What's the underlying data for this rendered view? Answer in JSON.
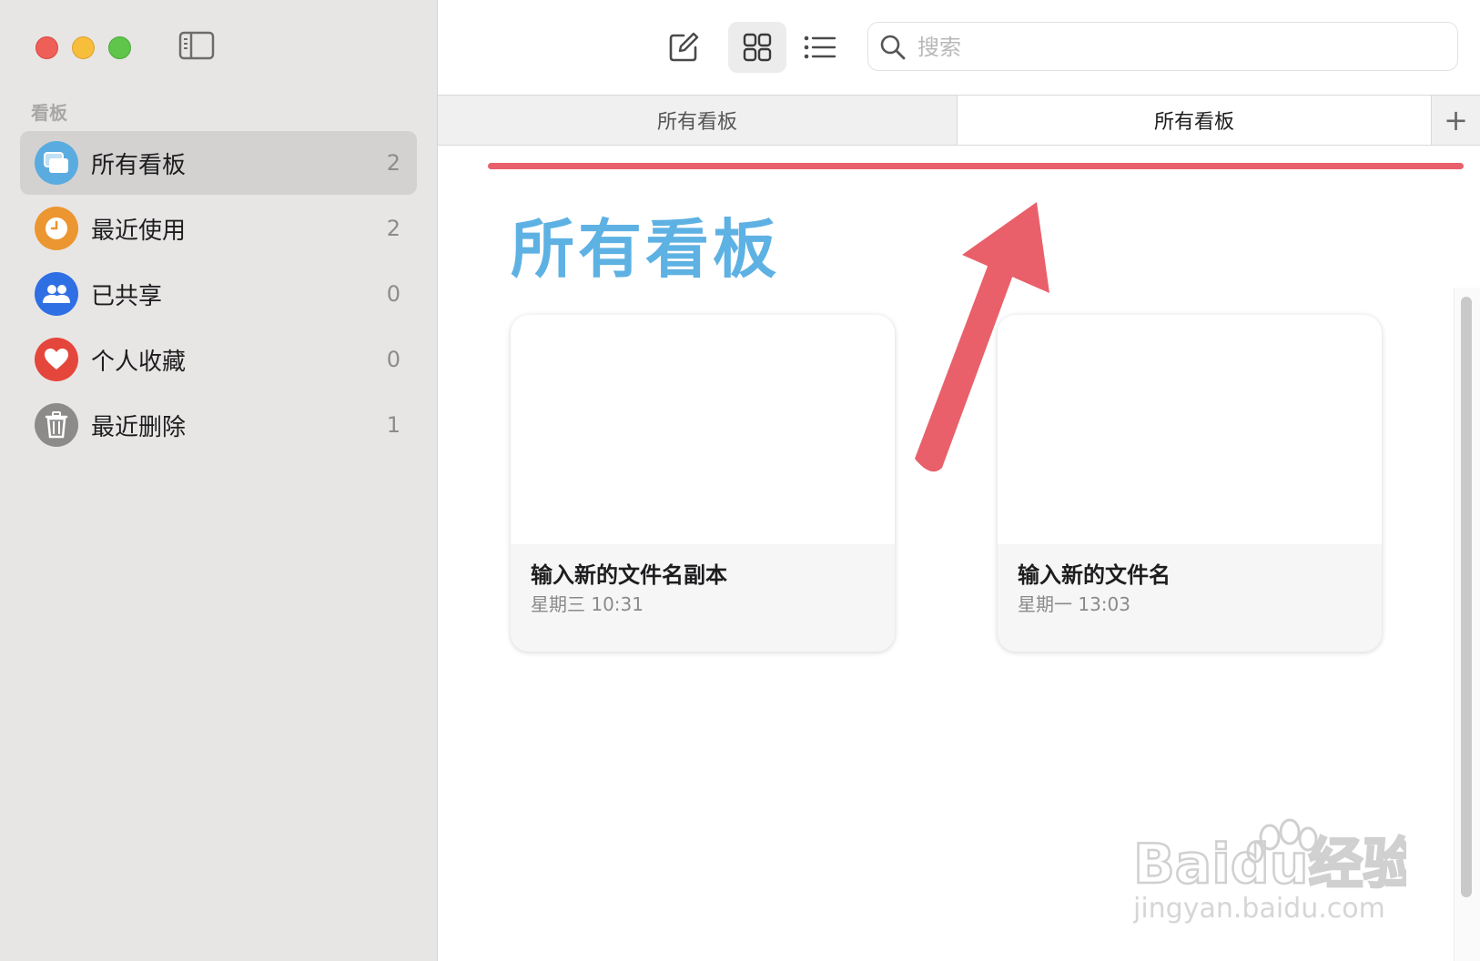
{
  "sidebar": {
    "section_label": "看板",
    "items": [
      {
        "label": "所有看板",
        "count": "2",
        "icon": "boards-icon",
        "color": "#5aace0"
      },
      {
        "label": "最近使用",
        "count": "2",
        "icon": "clock-icon",
        "color": "#eb9631"
      },
      {
        "label": "已共享",
        "count": "0",
        "icon": "people-icon",
        "color": "#2f6fe4"
      },
      {
        "label": "个人收藏",
        "count": "0",
        "icon": "heart-icon",
        "color": "#e5463b"
      },
      {
        "label": "最近删除",
        "count": "1",
        "icon": "trash-icon",
        "color": "#8d8b8a"
      }
    ]
  },
  "toolbar": {
    "search_placeholder": "搜索"
  },
  "tabs": [
    {
      "label": "所有看板"
    },
    {
      "label": "所有看板"
    }
  ],
  "tab_add_label": "+",
  "main": {
    "title": "所有看板",
    "title_color": "#5eb1e3",
    "cards": [
      {
        "title": "输入新的文件名副本",
        "date": "星期三 10:31"
      },
      {
        "title": "输入新的文件名",
        "date": "星期一 13:03"
      }
    ]
  },
  "annotation_color": "#e9606a",
  "watermark": {
    "text": "Baidu经验",
    "url_text": "jingyan.baidu.com"
  }
}
